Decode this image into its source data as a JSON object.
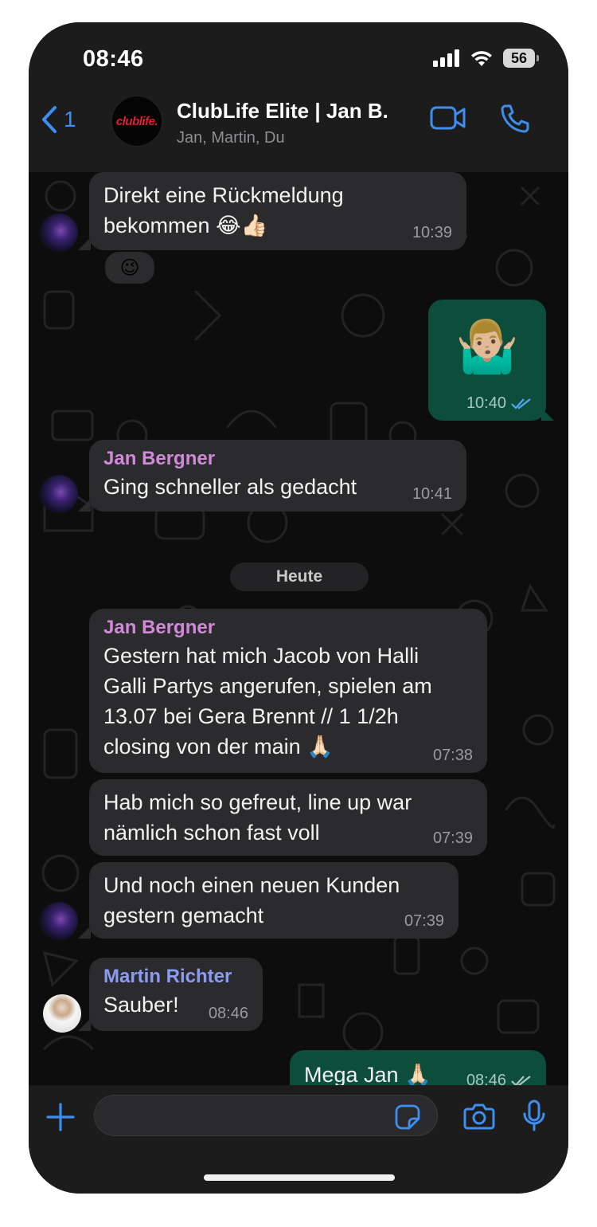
{
  "status_bar": {
    "time": "08:46",
    "battery": "56"
  },
  "header": {
    "back_count": "1",
    "avatar_logo": "clublife.",
    "title": "ClubLife Elite | Jan B.",
    "members": "Jan, Martin, Du"
  },
  "icons": {
    "back": "chevron-left-icon",
    "video": "video-camera-icon",
    "call": "phone-icon",
    "plus": "plus-icon",
    "sticker": "sticker-icon",
    "camera": "camera-icon",
    "mic": "microphone-icon",
    "read": "double-check-icon"
  },
  "colors": {
    "accent": "#3e8ef0",
    "incoming_bubble": "#2b2b2d",
    "outgoing_bubble": "#0d4d3c",
    "jan_name": "#d08ad8",
    "martin_name": "#8b9bf2"
  },
  "messages": [
    {
      "direction": "in",
      "sender": "",
      "text": "Direkt eine Rückmeldung\nbekommen 😂👍🏻",
      "time": "10:39",
      "reaction": "😉"
    },
    {
      "direction": "out",
      "text": "🤷🏼‍♂️",
      "time": "10:40",
      "status": "read"
    },
    {
      "direction": "in",
      "sender": "Jan Bergner",
      "text": "Ging schneller als gedacht",
      "time": "10:41"
    },
    {
      "direction": "in",
      "sender": "Jan Bergner",
      "text": "Gestern hat mich Jacob von Halli\nGalli Partys angerufen, spielen am\n13.07 bei Gera Brennt // 1 1/2h\nclosing von der main 🙏🏻",
      "time": "07:38"
    },
    {
      "direction": "in",
      "sender": "",
      "text": "Hab mich so gefreut, line up war\nnämlich schon fast voll",
      "time": "07:39"
    },
    {
      "direction": "in",
      "sender": "",
      "text": "Und noch einen neuen Kunden\ngestern gemacht",
      "time": "07:39"
    },
    {
      "direction": "in",
      "sender": "Martin Richter",
      "text": "Sauber!",
      "time": "08:46"
    },
    {
      "direction": "out",
      "text": "Mega Jan 🙏🏻",
      "time": "08:46",
      "status": "delivered"
    }
  ],
  "date_divider": "Heute",
  "composer": {
    "placeholder": ""
  }
}
